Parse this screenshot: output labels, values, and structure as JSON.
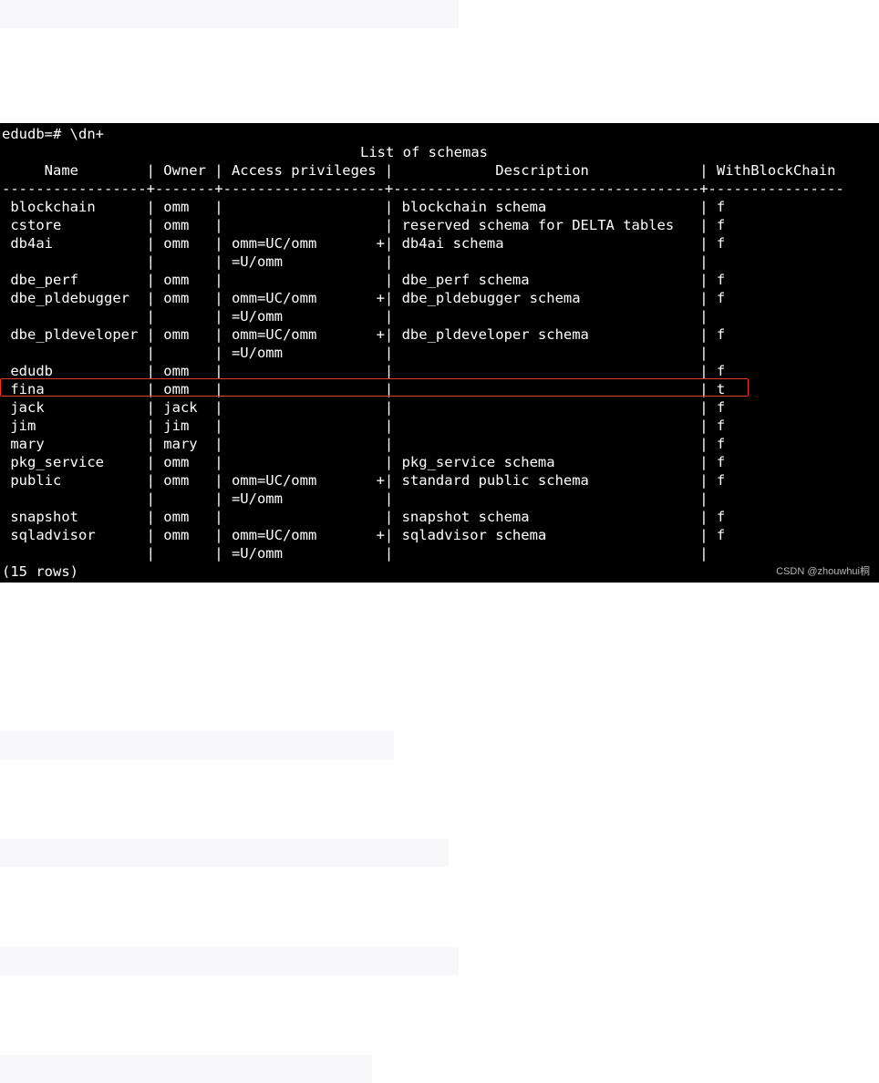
{
  "terminal": {
    "prompt_line": "edudb=# \\dn+",
    "title": "List of schemas",
    "header_row": "     Name        | Owner | Access privileges |            Description             | WithBlockChain",
    "separator": "-----------------+-------+-------------------+------------------------------------+----------------",
    "rows": [
      " blockchain      | omm   |                   | blockchain schema                  | f",
      " cstore          | omm   |                   | reserved schema for DELTA tables   | f",
      " db4ai           | omm   | omm=UC/omm       +| db4ai schema                       | f",
      "                 |       | =U/omm            |                                    |",
      " dbe_perf        | omm   |                   | dbe_perf schema                    | f",
      " dbe_pldebugger  | omm   | omm=UC/omm       +| dbe_pldebugger schema              | f",
      "                 |       | =U/omm            |                                    |",
      " dbe_pldeveloper | omm   | omm=UC/omm       +| dbe_pldeveloper schema             | f",
      "                 |       | =U/omm            |                                    |",
      " edudb           | omm   |                   |                                    | f",
      " fina            | omm   |                   |                                    | t",
      " jack            | jack  |                   |                                    | f",
      " jim             | jim   |                   |                                    | f",
      " mary            | mary  |                   |                                    | f",
      " pkg_service     | omm   |                   | pkg_service schema                 | f",
      " public          | omm   | omm=UC/omm       +| standard public schema             | f",
      "                 |       | =U/omm            |                                    |",
      " snapshot        | omm   |                   | snapshot schema                    | f",
      " sqladvisor      | omm   | omm=UC/omm       +| sqladvisor schema                  | f",
      "                 |       | =U/omm            |                                    |"
    ],
    "footer": "(15 rows)",
    "watermark": "CSDN @zhouwhui桐",
    "background": "#000000",
    "text_color": "#ffffff",
    "highlight_color": "#e03a2f"
  }
}
